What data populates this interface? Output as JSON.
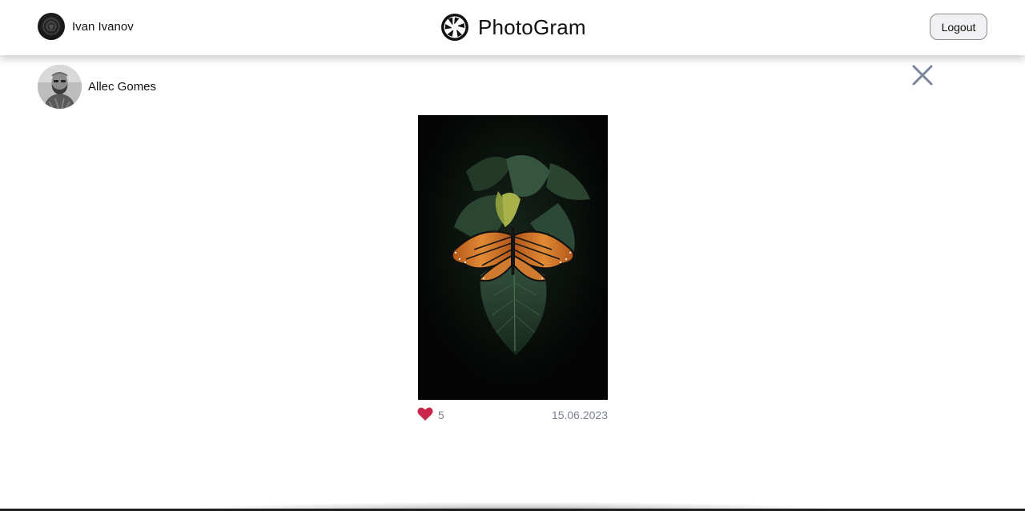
{
  "header": {
    "current_user_name": "Ivan Ivanov",
    "brand_name": "PhotoGram",
    "logout_label": "Logout"
  },
  "post": {
    "author_name": "Allec Gomes",
    "likes": "5",
    "date": "15.06.2023",
    "liked": true
  },
  "icons": {
    "close": "close-icon",
    "like": "heart-icon",
    "logo": "camera-aperture-icon"
  },
  "colors": {
    "like": "#c8264a",
    "meta_text": "#7a8094",
    "close_icon": "#7c8699"
  }
}
